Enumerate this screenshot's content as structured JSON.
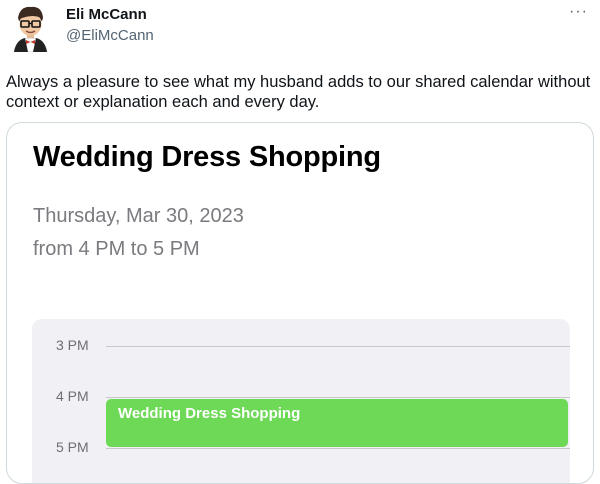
{
  "tweet": {
    "author_name": "Eli McCann",
    "author_handle": "@EliMcCann",
    "more_icon": "ellipsis-icon",
    "text": "Always a pleasure to see what my husband adds to our shared calendar without context or explanation each and every day."
  },
  "calendar_event": {
    "title": "Wedding Dress Shopping",
    "date": "Thursday, Mar 30, 2023",
    "time_range": "from 4 PM to 5 PM",
    "hours": [
      "3 PM",
      "4 PM",
      "5 PM"
    ],
    "block_label": "Wedding Dress Shopping",
    "block_color": "#6dd957"
  }
}
